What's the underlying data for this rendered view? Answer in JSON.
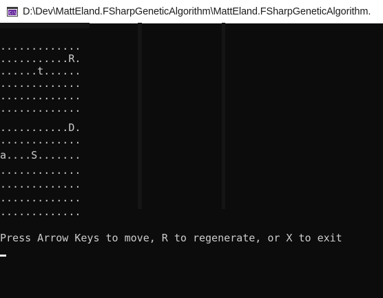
{
  "window": {
    "title": "D:\\Dev\\MattEland.FSharpGeneticAlgorithm\\MattEland.FSharpGeneticAlgorithm.",
    "icon": "console-app-icon"
  },
  "console": {
    "grid_rows": [
      ".............",
      "...........R.",
      "......t......",
      ".............",
      ".............",
      ".............",
      "...........D.",
      ".............",
      "a....S.......",
      ".............",
      ".............",
      ".............",
      "............."
    ],
    "prompt": "Press Arrow Keys to move, R to regenerate, or X to exit"
  },
  "colors": {
    "background": "#0c0c0c",
    "text": "#cccccc",
    "titlebar": "#ffffff",
    "icon_accent": "#6b2fa0"
  }
}
